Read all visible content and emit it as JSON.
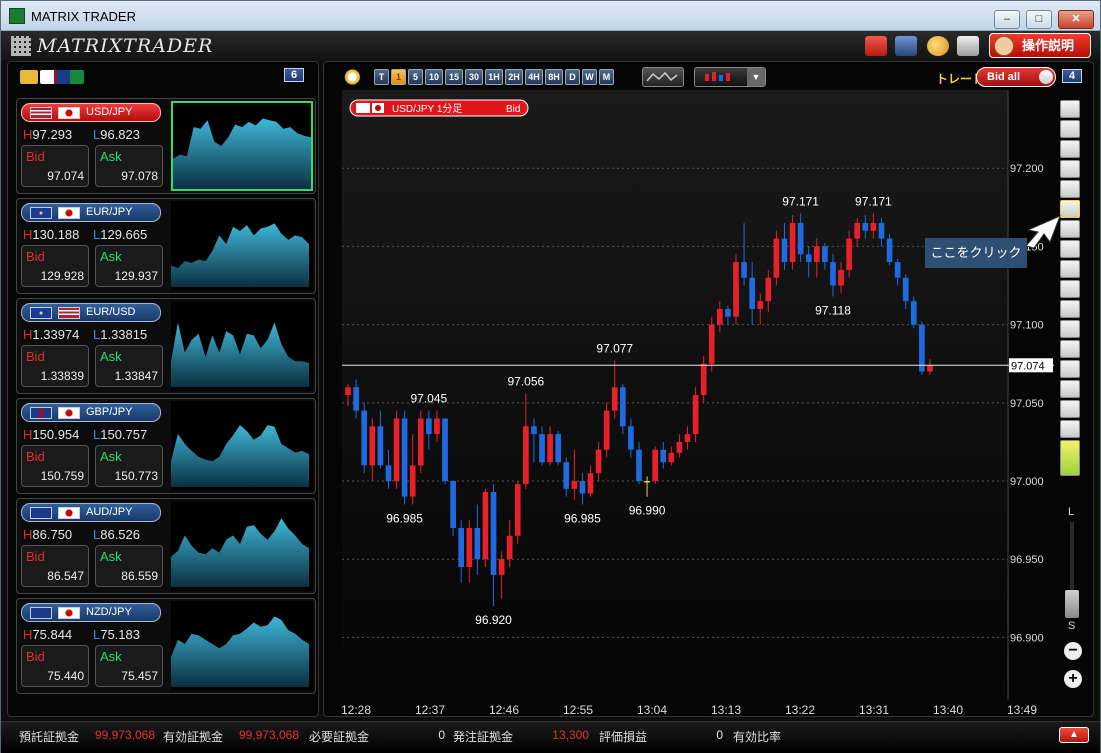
{
  "window": {
    "title": "MATRIX TRADER"
  },
  "toolbar": {
    "logo_text": "MATRIXTRADER",
    "help_label": "操作説明",
    "icons": [
      "briefcase-icon",
      "save-icon",
      "palette-icon",
      "print-icon"
    ]
  },
  "left_panel": {
    "count": "6",
    "pairs": [
      {
        "name": "USD/JPY",
        "high_label": "H",
        "high": "97.293",
        "low_label": "L",
        "low": "96.823",
        "bid_label": "Bid",
        "bid": "97.074",
        "ask_label": "Ask",
        "ask": "97.078",
        "active": true,
        "spark": [
          0.35,
          0.4,
          0.38,
          0.72,
          0.7,
          0.8,
          0.55,
          0.5,
          0.6,
          0.75,
          0.72,
          0.78,
          0.74,
          0.82,
          0.8,
          0.78,
          0.7,
          0.72,
          0.65,
          0.62,
          0.6
        ]
      },
      {
        "name": "EUR/JPY",
        "high_label": "H",
        "high": "130.188",
        "low_label": "L",
        "low": "129.665",
        "bid_label": "Bid",
        "bid": "129.928",
        "ask_label": "Ask",
        "ask": "129.937",
        "active": false,
        "spark": [
          0.25,
          0.22,
          0.3,
          0.28,
          0.32,
          0.3,
          0.42,
          0.6,
          0.5,
          0.7,
          0.65,
          0.72,
          0.6,
          0.68,
          0.7,
          0.74,
          0.62,
          0.55,
          0.6,
          0.58,
          0.5
        ]
      },
      {
        "name": "EUR/USD",
        "high_label": "H",
        "high": "1.33974",
        "low_label": "L",
        "low": "1.33815",
        "bid_label": "Bid",
        "bid": "1.33839",
        "ask_label": "Ask",
        "ask": "1.33847",
        "active": false,
        "spark": [
          0.3,
          0.75,
          0.4,
          0.55,
          0.62,
          0.35,
          0.6,
          0.4,
          0.65,
          0.6,
          0.38,
          0.62,
          0.6,
          0.45,
          0.55,
          0.75,
          0.5,
          0.35,
          0.3,
          0.3,
          0.28
        ]
      },
      {
        "name": "GBP/JPY",
        "high_label": "H",
        "high": "150.954",
        "low_label": "L",
        "low": "150.757",
        "bid_label": "Bid",
        "bid": "150.759",
        "ask_label": "Ask",
        "ask": "150.773",
        "active": false,
        "spark": [
          0.3,
          0.62,
          0.5,
          0.42,
          0.35,
          0.32,
          0.3,
          0.35,
          0.5,
          0.6,
          0.72,
          0.65,
          0.55,
          0.6,
          0.72,
          0.7,
          0.5,
          0.45,
          0.4,
          0.42,
          0.38
        ]
      },
      {
        "name": "AUD/JPY",
        "high_label": "H",
        "high": "86.750",
        "low_label": "L",
        "low": "86.526",
        "bid_label": "Bid",
        "bid": "86.547",
        "ask_label": "Ask",
        "ask": "86.559",
        "active": false,
        "spark": [
          0.35,
          0.42,
          0.6,
          0.48,
          0.4,
          0.38,
          0.45,
          0.4,
          0.55,
          0.6,
          0.5,
          0.7,
          0.72,
          0.62,
          0.55,
          0.65,
          0.8,
          0.68,
          0.6,
          0.5,
          0.45
        ]
      },
      {
        "name": "NZD/JPY",
        "high_label": "H",
        "high": "75.844",
        "low_label": "L",
        "low": "75.183",
        "bid_label": "Bid",
        "bid": "75.440",
        "ask_label": "Ask",
        "ask": "75.457",
        "active": false,
        "spark": [
          0.35,
          0.55,
          0.5,
          0.62,
          0.6,
          0.55,
          0.5,
          0.45,
          0.5,
          0.6,
          0.62,
          0.68,
          0.75,
          0.7,
          0.72,
          0.82,
          0.78,
          0.66,
          0.62,
          0.55,
          0.5
        ]
      }
    ]
  },
  "chart_panel": {
    "count": "4",
    "timeframes": [
      "T",
      "1",
      "5",
      "10",
      "15",
      "30",
      "1H",
      "2H",
      "4H",
      "8H",
      "D",
      "W",
      "M"
    ],
    "selected_timeframe": "1",
    "trade_label": "トレード",
    "bid_all_label": "Bid all",
    "chart_tag_label": "USD/JPY 1分足",
    "chart_tag_side": "Bid",
    "callout": "ここをクリック",
    "side_tool_icons": [
      "info-icon",
      "news-icon",
      "flag-icon",
      "bell-icon",
      "color-icon",
      "pointer-icon",
      "crosshair-icon",
      "trendline-icon",
      "horizontal-line-icon",
      "vertical-line-icon",
      "fib-icon",
      "channel-icon",
      "level-icon",
      "fan-icon",
      "ruler-icon",
      "pencil-icon",
      "trash-icon",
      "bar-toggle-icon"
    ],
    "zoom_large": "L",
    "zoom_small": "S"
  },
  "chart_data": {
    "type": "candlestick",
    "y_ticks": [
      "97.200",
      "97.150",
      "97.100",
      "97.050",
      "97.000",
      "96.950",
      "96.900"
    ],
    "ylim": [
      96.86,
      97.25
    ],
    "x_ticks": [
      "12:28",
      "12:37",
      "12:46",
      "12:55",
      "13:04",
      "13:13",
      "13:22",
      "13:31",
      "13:40",
      "13:49"
    ],
    "current_price": "97.074",
    "annotations": [
      {
        "text": "97.045",
        "index": 10,
        "at": "above",
        "value": 97.045
      },
      {
        "text": "96.985",
        "index": 7,
        "at": "below",
        "value": 96.985
      },
      {
        "text": "97.056",
        "index": 22,
        "at": "above",
        "value": 97.056
      },
      {
        "text": "96.920",
        "index": 18,
        "at": "below",
        "value": 96.92
      },
      {
        "text": "97.077",
        "index": 33,
        "at": "above",
        "value": 97.077
      },
      {
        "text": "96.985",
        "index": 29,
        "at": "below",
        "value": 96.985
      },
      {
        "text": "96.990",
        "index": 37,
        "at": "below",
        "value": 96.99
      },
      {
        "text": "97.171",
        "index": 56,
        "at": "above",
        "value": 97.171
      },
      {
        "text": "97.118",
        "index": 60,
        "at": "below",
        "value": 97.118
      },
      {
        "text": "97.171",
        "index": 65,
        "at": "above",
        "value": 97.171
      }
    ],
    "candles": [
      [
        97.055,
        97.062,
        97.048,
        97.06
      ],
      [
        97.06,
        97.065,
        97.04,
        97.045
      ],
      [
        97.045,
        97.05,
        97.005,
        97.01
      ],
      [
        97.01,
        97.04,
        97.0,
        97.035
      ],
      [
        97.035,
        97.045,
        97.008,
        97.01
      ],
      [
        97.01,
        97.02,
        96.995,
        97.0
      ],
      [
        97.0,
        97.045,
        96.995,
        97.04
      ],
      [
        97.04,
        97.045,
        96.985,
        96.99
      ],
      [
        96.99,
        97.03,
        96.985,
        97.01
      ],
      [
        97.01,
        97.045,
        97.005,
        97.04
      ],
      [
        97.04,
        97.045,
        97.02,
        97.03
      ],
      [
        97.03,
        97.045,
        97.025,
        97.04
      ],
      [
        97.04,
        97.04,
        96.998,
        97.0
      ],
      [
        97.0,
        97.0,
        96.965,
        96.97
      ],
      [
        96.97,
        96.975,
        96.935,
        96.945
      ],
      [
        96.945,
        96.975,
        96.935,
        96.97
      ],
      [
        96.97,
        96.985,
        96.94,
        96.95
      ],
      [
        96.95,
        96.995,
        96.945,
        96.993
      ],
      [
        96.993,
        96.998,
        96.92,
        96.94
      ],
      [
        96.94,
        96.955,
        96.925,
        96.95
      ],
      [
        96.95,
        96.975,
        96.945,
        96.965
      ],
      [
        96.965,
        97.0,
        96.96,
        96.998
      ],
      [
        96.998,
        97.056,
        96.995,
        97.035
      ],
      [
        97.035,
        97.04,
        97.012,
        97.03
      ],
      [
        97.03,
        97.035,
        97.01,
        97.012
      ],
      [
        97.012,
        97.035,
        97.01,
        97.03
      ],
      [
        97.03,
        97.032,
        97.01,
        97.012
      ],
      [
        97.012,
        97.015,
        96.99,
        96.995
      ],
      [
        96.995,
        97.02,
        96.988,
        97.0
      ],
      [
        97.0,
        97.005,
        96.985,
        96.992
      ],
      [
        96.992,
        97.01,
        96.99,
        97.005
      ],
      [
        97.005,
        97.025,
        97.0,
        97.02
      ],
      [
        97.02,
        97.05,
        97.015,
        97.045
      ],
      [
        97.045,
        97.077,
        97.04,
        97.06
      ],
      [
        97.06,
        97.062,
        97.03,
        97.035
      ],
      [
        97.035,
        97.04,
        97.015,
        97.02
      ],
      [
        97.02,
        97.025,
        96.998,
        97.0
      ],
      [
        97.0,
        97.003,
        96.99,
        97.0
      ],
      [
        97.0,
        97.022,
        96.998,
        97.02
      ],
      [
        97.02,
        97.025,
        97.008,
        97.012
      ],
      [
        97.012,
        97.022,
        97.01,
        97.018
      ],
      [
        97.018,
        97.03,
        97.015,
        97.025
      ],
      [
        97.025,
        97.035,
        97.02,
        97.03
      ],
      [
        97.03,
        97.06,
        97.025,
        97.055
      ],
      [
        97.055,
        97.08,
        97.05,
        97.075
      ],
      [
        97.075,
        97.105,
        97.07,
        97.1
      ],
      [
        97.1,
        97.115,
        97.095,
        97.11
      ],
      [
        97.11,
        97.112,
        97.1,
        97.105
      ],
      [
        97.105,
        97.145,
        97.1,
        97.14
      ],
      [
        97.14,
        97.165,
        97.125,
        97.13
      ],
      [
        97.13,
        97.14,
        97.1,
        97.11
      ],
      [
        97.11,
        97.12,
        97.1,
        97.115
      ],
      [
        97.115,
        97.135,
        97.108,
        97.13
      ],
      [
        97.13,
        97.16,
        97.125,
        97.155
      ],
      [
        97.155,
        97.165,
        97.135,
        97.14
      ],
      [
        97.14,
        97.17,
        97.135,
        97.165
      ],
      [
        97.165,
        97.171,
        97.14,
        97.145
      ],
      [
        97.145,
        97.15,
        97.13,
        97.14
      ],
      [
        97.14,
        97.155,
        97.13,
        97.15
      ],
      [
        97.15,
        97.152,
        97.135,
        97.14
      ],
      [
        97.14,
        97.145,
        97.118,
        97.125
      ],
      [
        97.125,
        97.14,
        97.12,
        97.135
      ],
      [
        97.135,
        97.16,
        97.13,
        97.155
      ],
      [
        97.155,
        97.168,
        97.15,
        97.165
      ],
      [
        97.165,
        97.17,
        97.155,
        97.16
      ],
      [
        97.16,
        97.171,
        97.155,
        97.165
      ],
      [
        97.165,
        97.168,
        97.15,
        97.155
      ],
      [
        97.155,
        97.158,
        97.138,
        97.14
      ],
      [
        97.14,
        97.142,
        97.125,
        97.13
      ],
      [
        97.13,
        97.132,
        97.11,
        97.115
      ],
      [
        97.115,
        97.118,
        97.098,
        97.1
      ],
      [
        97.1,
        97.102,
        97.068,
        97.07
      ],
      [
        97.07,
        97.078,
        97.068,
        97.074
      ]
    ]
  },
  "status_bar": {
    "deposit_label": "預託証拠金",
    "deposit": "99,973,068",
    "effective_label": "有効証拠金",
    "effective": "99,973,068",
    "required_label": "必要証拠金",
    "required": "0",
    "order_label": "発注証拠金",
    "order": "13,300",
    "pnl_label": "評価損益",
    "pnl": "0",
    "ratio_label": "有効比率"
  },
  "colors": {
    "up": "#e8202a",
    "down": "#1f6ae0",
    "accent_green": "#2ddc6c",
    "sparkline": "#3fb6d8"
  }
}
